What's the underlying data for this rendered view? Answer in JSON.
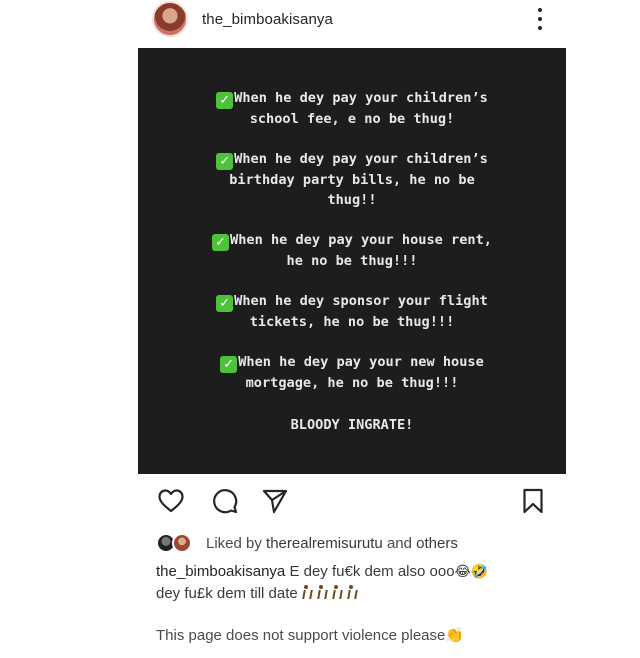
{
  "post": {
    "username": "the_bimboakisanya",
    "image_text": {
      "lines": [
        "When he dey pay your children’s\nschool fee, e no be thug!",
        "When he dey pay your children’s\nbirthday party bills, he no be\nthug!!",
        "When he dey pay your house rent,\nhe no be thug!!!",
        "When he dey sponsor your flight\ntickets, he no be thug!!!",
        "When he dey pay your new house\nmortgage, he no be thug!!!"
      ],
      "closing": "BLOODY INGRATE!"
    }
  },
  "likes": {
    "prefix": "Liked by",
    "user": "therealremisurutu",
    "connector": "and",
    "others": "others"
  },
  "caption": {
    "author": "the_bimboakisanya",
    "text_line1": "E dey fu€k dem also ooo",
    "emoji1": "😂",
    "emoji2": "🤣",
    "text_line2": "dey fu£k dem till date"
  },
  "comment": {
    "text": "This page does not support violence please",
    "emoji": "👏"
  },
  "icons": {
    "like": "heart-icon",
    "comment": "comment-bubble-icon",
    "share": "paper-plane-icon",
    "save": "bookmark-icon",
    "more": "more-vertical-icon"
  },
  "colors": {
    "image_background": "#1d1d1d",
    "checkmark": "#4ec23a",
    "text": "#262626"
  }
}
